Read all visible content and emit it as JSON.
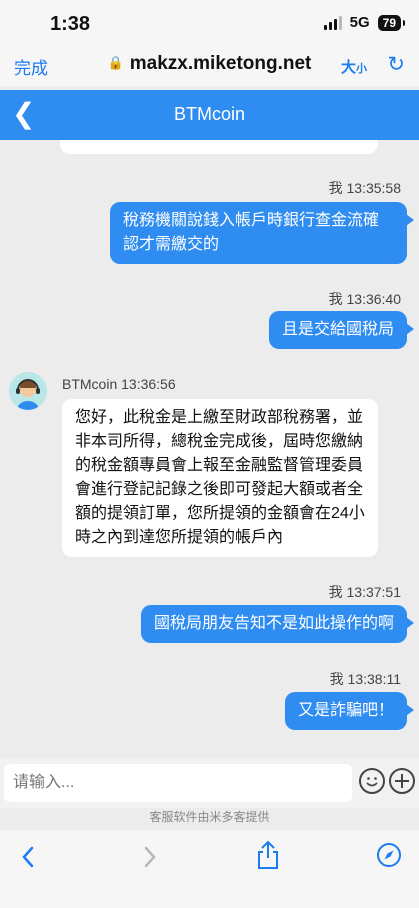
{
  "status": {
    "time": "1:38",
    "network": "5G",
    "battery": "79"
  },
  "browser": {
    "done_label": "完成",
    "url": "makzx.miketong.net",
    "text_size_label": "大",
    "text_size_small": "小"
  },
  "chat_header": {
    "title": "BTMcoin"
  },
  "messages": [
    {
      "meta": "我 13:35:58",
      "text": "稅務機關說錢入帳戶時銀行查金流確認才需繳交的"
    },
    {
      "meta": "我 13:36:40",
      "text": "且是交給國稅局"
    },
    {
      "meta": "BTMcoin 13:36:56",
      "text": "您好，此稅金是上繳至財政部稅務署，並非本司所得，總稅金完成後，屆時您繳納的稅金額專員會上報至金融監督管理委員會進行登記記錄之後即可發起大額或者全額的提領訂單，您所提領的金額會在24小時之內到達您所提領的帳戶內"
    },
    {
      "meta": "我 13:37:51",
      "text": "國稅局朋友告知不是如此操作的啊"
    },
    {
      "meta": "我 13:38:11",
      "text": "又是詐騙吧！"
    }
  ],
  "input": {
    "placeholder": "请输入..."
  },
  "footer": {
    "credit": "客服软件由米多客提供"
  },
  "colors": {
    "accent": "#2f8cf0",
    "link": "#1c7cf0"
  }
}
